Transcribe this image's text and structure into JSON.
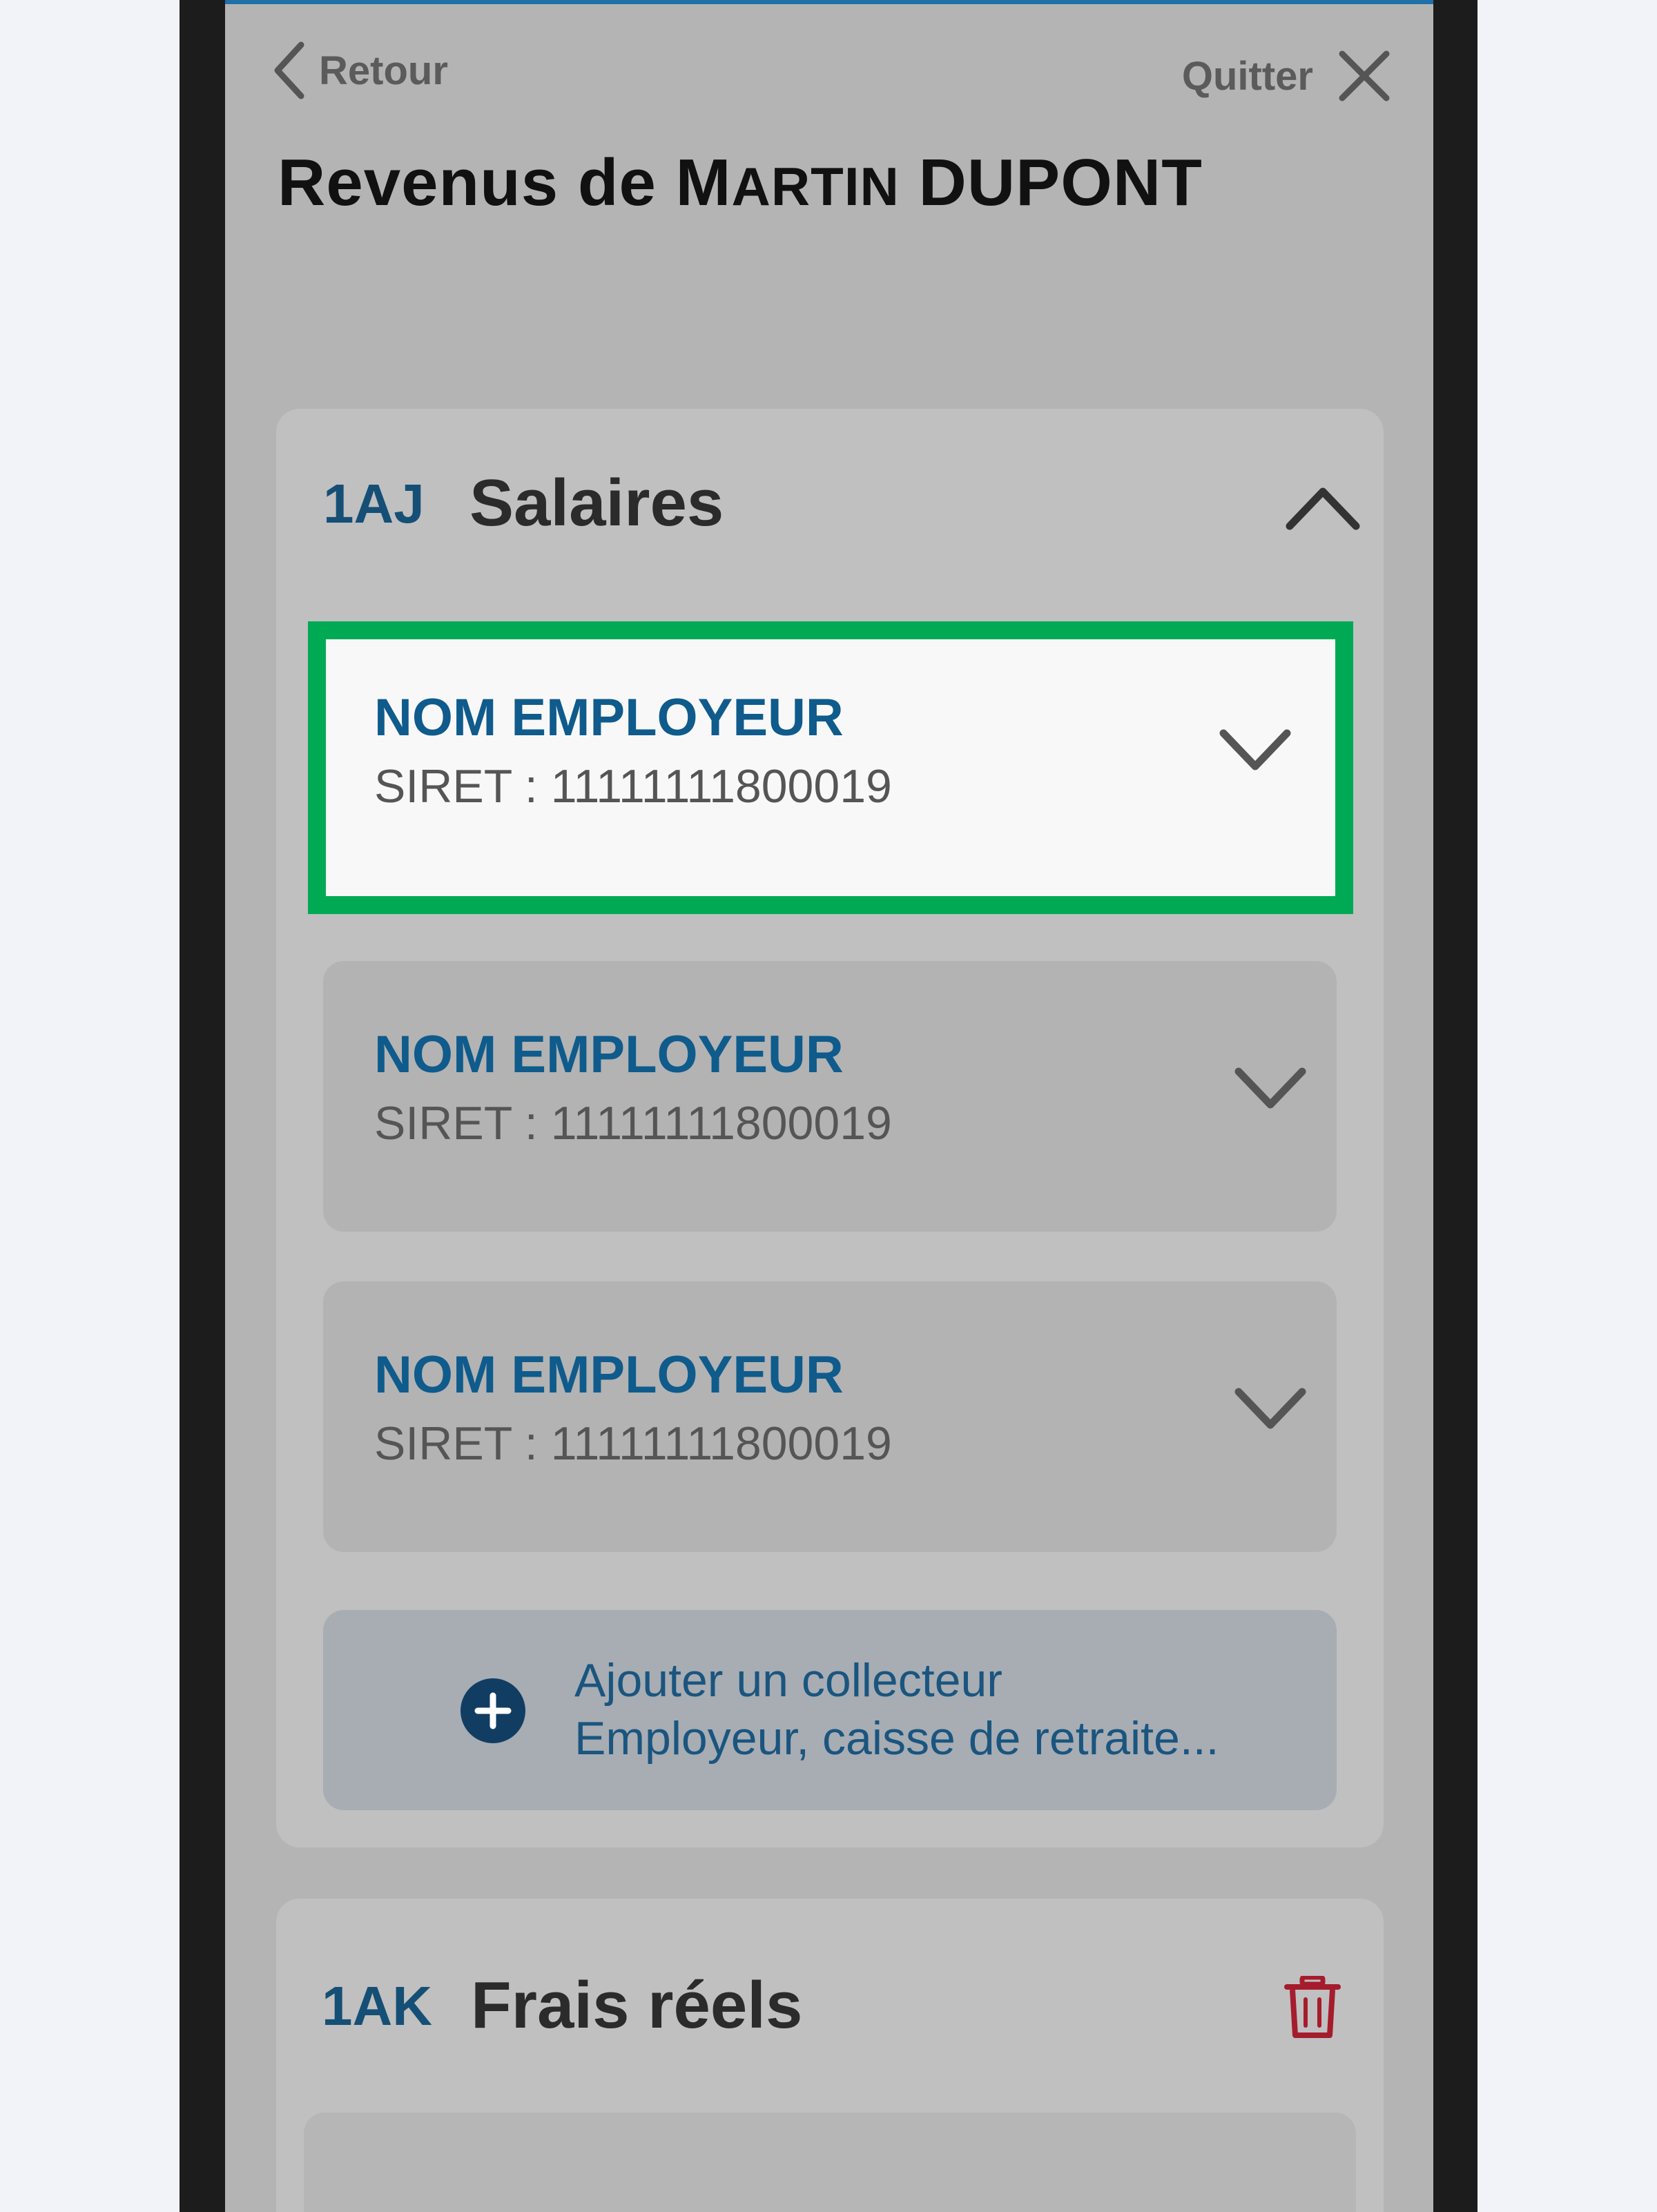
{
  "nav": {
    "back_label": "Retour",
    "quit_label": "Quitter"
  },
  "title": {
    "prefix": "Revenus de ",
    "first_initial": "M",
    "first_rest": "ARTIN",
    "first_last": "N",
    "last_name": "DUPONT"
  },
  "sections": [
    {
      "code": "1AJ",
      "title": "Salaires",
      "employers": [
        {
          "name": "NOM EMPLOYEUR",
          "siret": "SIRET : 11111111800019",
          "selected": true
        },
        {
          "name": "NOM EMPLOYEUR",
          "siret": "SIRET : 11111111800019",
          "selected": false
        },
        {
          "name": "NOM EMPLOYEUR",
          "siret": "SIRET : 11111111800019",
          "selected": false
        }
      ],
      "add_button": {
        "line1": "Ajouter un collecteur",
        "line2": "Employeur, caisse de retraite..."
      }
    },
    {
      "code": "1AK",
      "title": "Frais réels"
    }
  ],
  "colors": {
    "accent": "#0f5b8c",
    "highlight": "#00aa55",
    "danger": "#a51c2c"
  },
  "icons": {
    "back": "chevron-left-icon",
    "quit": "close-icon",
    "collapse": "chevron-up-icon",
    "expand": "chevron-down-icon",
    "add": "plus-circle-icon",
    "delete": "trash-icon"
  }
}
